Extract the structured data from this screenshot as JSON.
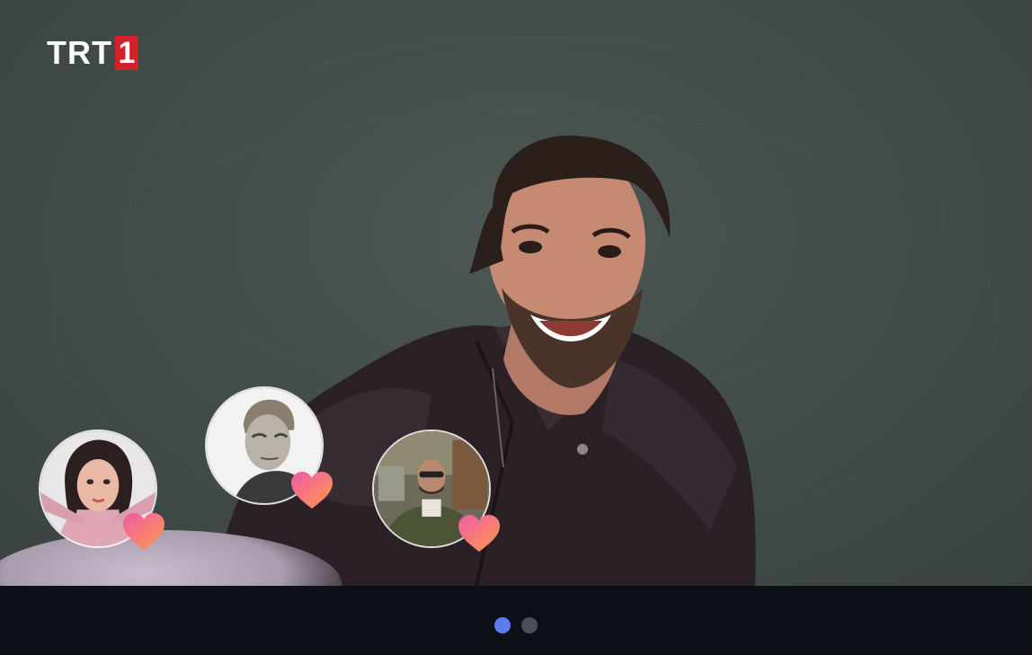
{
  "brand": {
    "logo_text": "TRT",
    "logo_number": "1",
    "logo_color": "#d3202a"
  },
  "hero": {
    "image": "smiling-man-in-water"
  },
  "avatars": [
    {
      "name": "avatar-woman-pink",
      "reaction": "heart"
    },
    {
      "name": "avatar-man-blond-bw",
      "reaction": "heart"
    },
    {
      "name": "avatar-man-sunglasses",
      "reaction": "heart"
    }
  ],
  "carousel": {
    "total": 2,
    "active": 1,
    "active_color": "#5b7cf0",
    "inactive_color": "#4a5059"
  }
}
